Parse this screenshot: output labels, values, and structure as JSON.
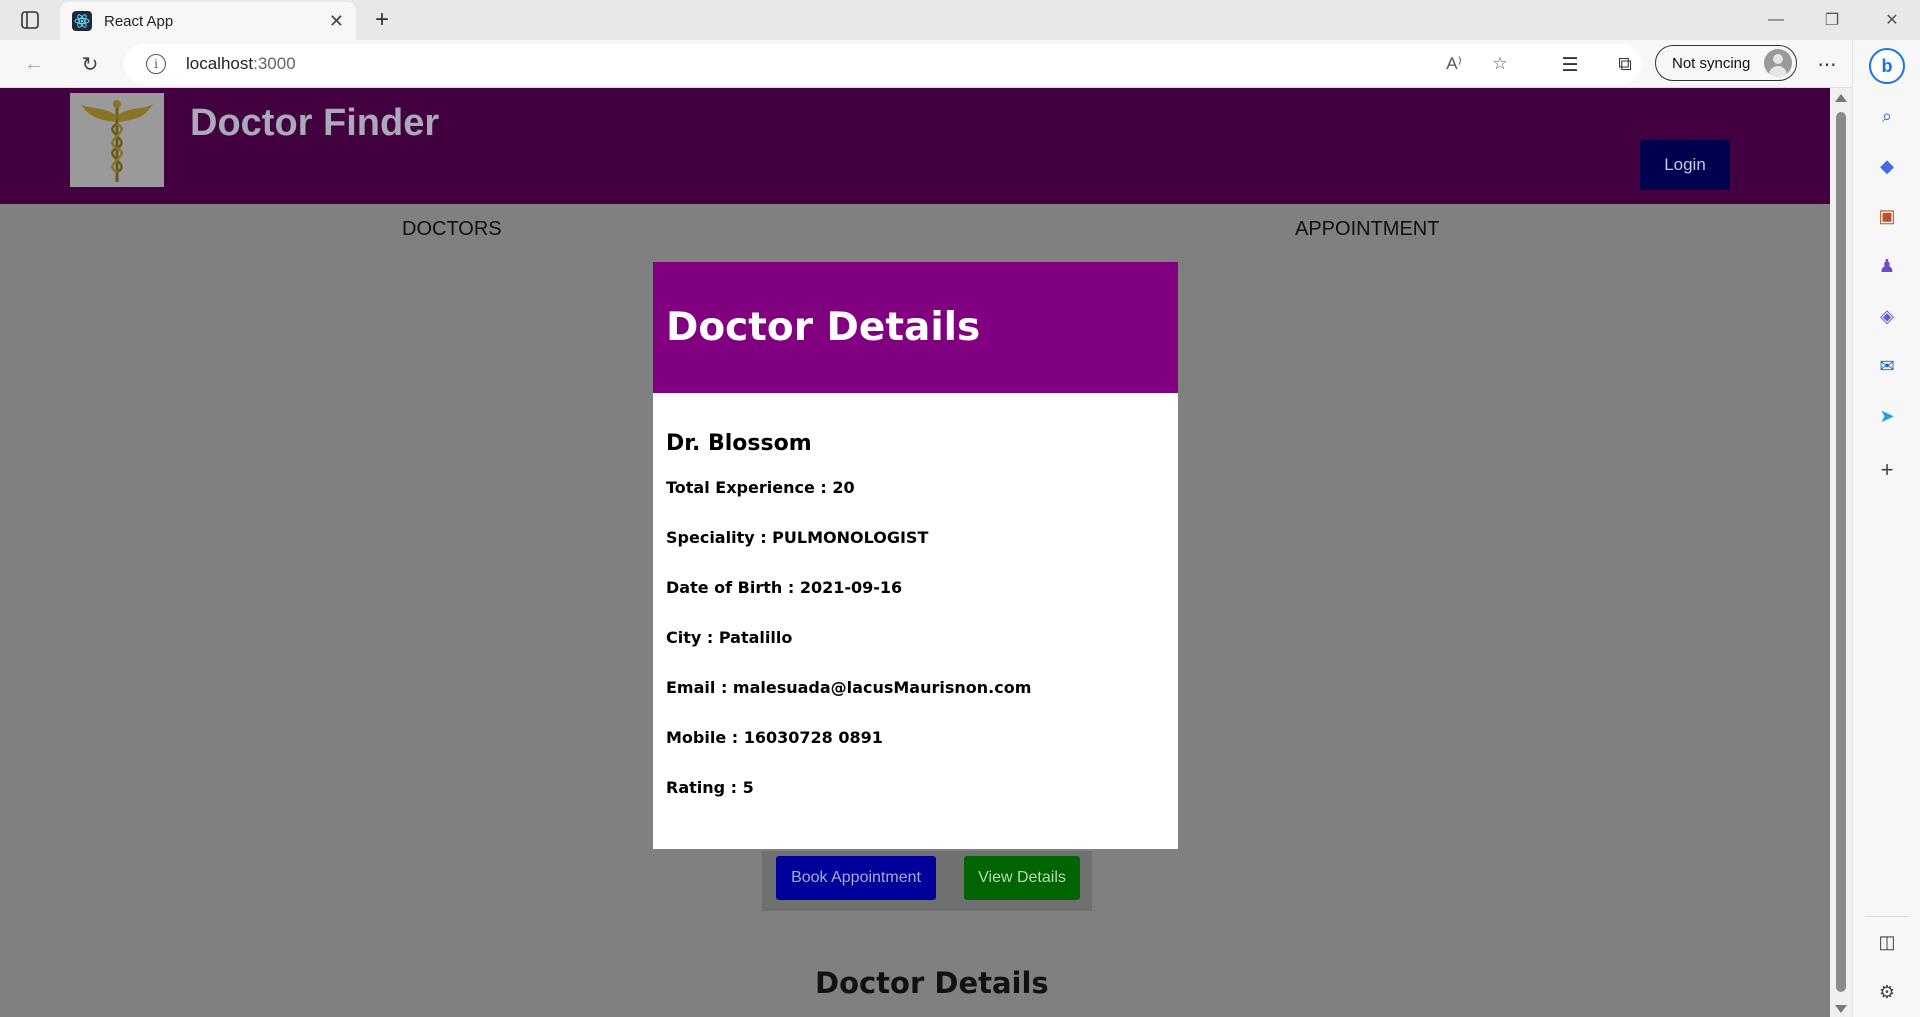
{
  "browser": {
    "tab_title": "React App",
    "url_host": "localhost",
    "url_port": ":3000",
    "sync_label": "Not syncing"
  },
  "app": {
    "title": "Doctor Finder",
    "login_label": "Login",
    "nav": {
      "doctors": "DOCTORS",
      "appointment": "APPOINTMENT"
    },
    "card_buttons": {
      "book": "Book Appointment",
      "view": "View Details"
    },
    "under_title": "Doctor Details"
  },
  "modal": {
    "title": "Doctor Details",
    "doctor_name": "Dr. Blossom",
    "details": [
      "Total Experience : 20",
      "Speciality : PULMONOLOGIST",
      "Date of Birth : 2021-09-16",
      "City : Patalillo",
      "Email : malesuada@lacusMaurisnon.com",
      "Mobile : 16030728 0891",
      "Rating : 5"
    ]
  },
  "colors": {
    "header_bg": "#420040",
    "modal_header_bg": "#800080",
    "login_bg": "#000050",
    "book_bg": "#00009a",
    "view_bg": "#006400",
    "page_bg": "#808080"
  },
  "icons": {
    "tab_favicon": "react-icon",
    "logo": "caduceus-icon"
  }
}
